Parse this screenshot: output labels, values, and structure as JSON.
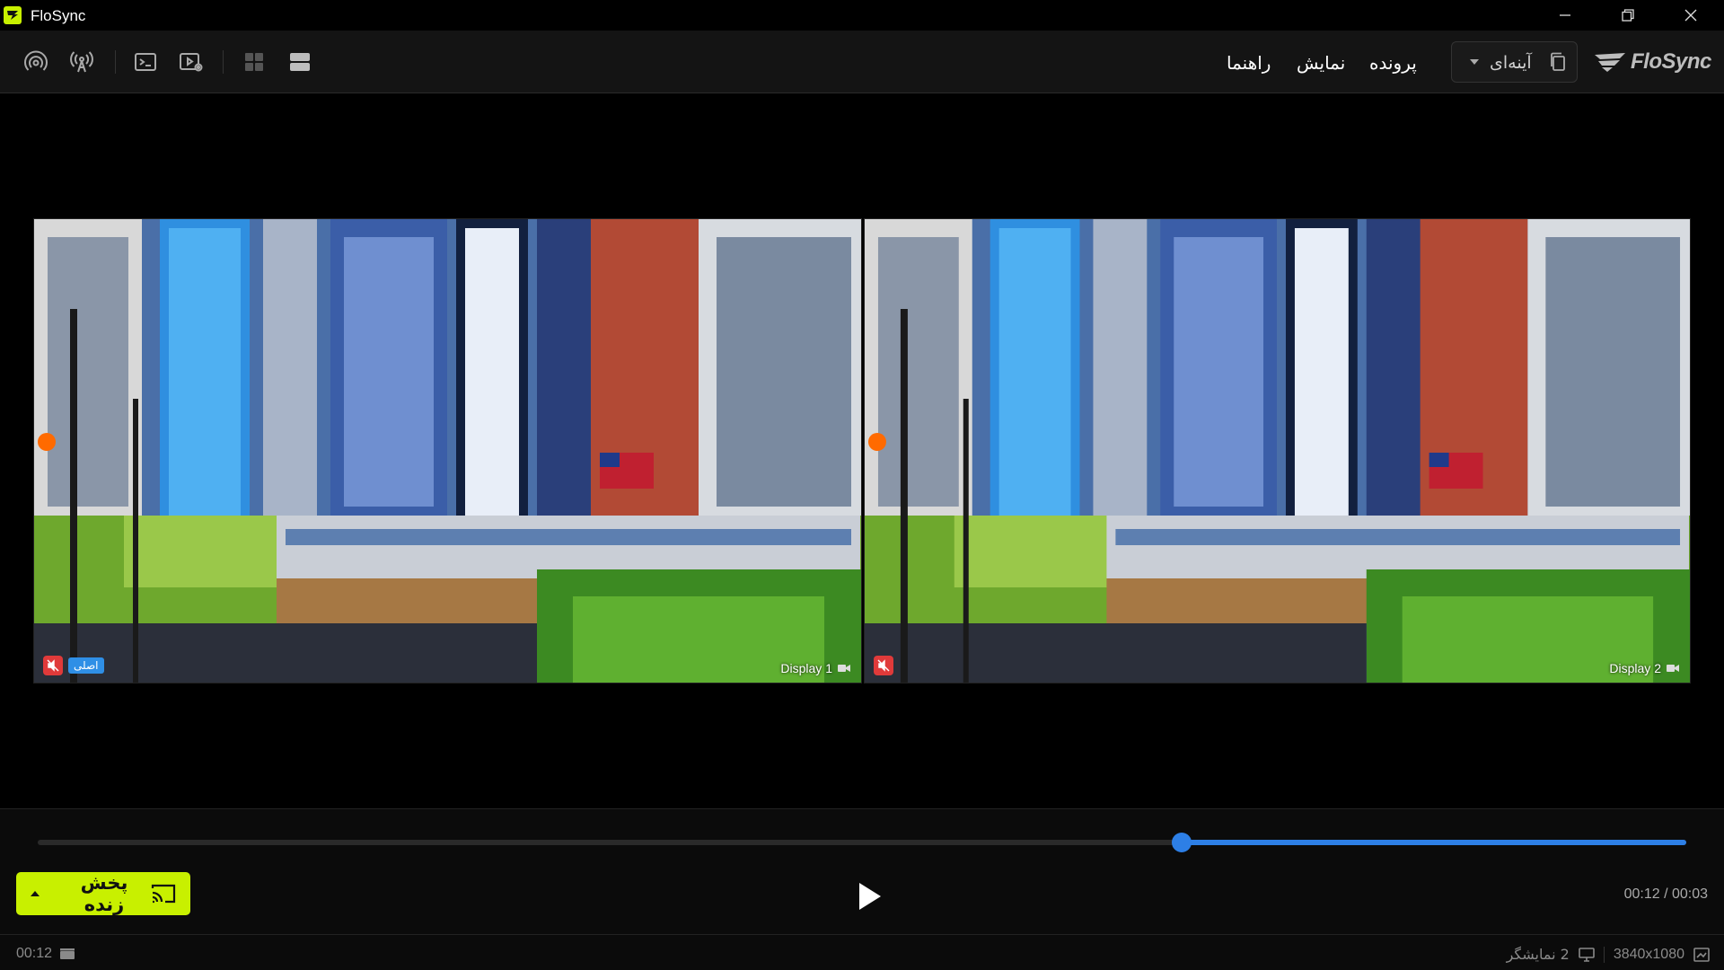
{
  "window": {
    "title": "FloSync"
  },
  "menu": {
    "file": "پرونده",
    "view": "نمایش",
    "help": "راهنما"
  },
  "mode_select": {
    "value": "آینه‌ای"
  },
  "brand": {
    "name": "FloSync"
  },
  "toolbar_icons": [
    "broadcast-icon",
    "antenna-icon",
    "terminal-icon",
    "video-settings-icon",
    "grid-layout-icon",
    "stacked-layout-icon"
  ],
  "displays": [
    {
      "label": "Display 1",
      "primary_badge": "اصلی",
      "muted": true
    },
    {
      "label": "Display 2",
      "muted": true
    }
  ],
  "playback": {
    "progress": 0.694,
    "time_readout": "00:12 / 00:03"
  },
  "live_button": {
    "label": "پخش زنده"
  },
  "status": {
    "duration": "00:12",
    "displays_count": "2 نمایشگر",
    "resolution": "3840x1080"
  },
  "colors": {
    "accent_green": "#c8f000",
    "accent_blue": "#2d7fe6",
    "mute_red": "#e03a3a"
  }
}
